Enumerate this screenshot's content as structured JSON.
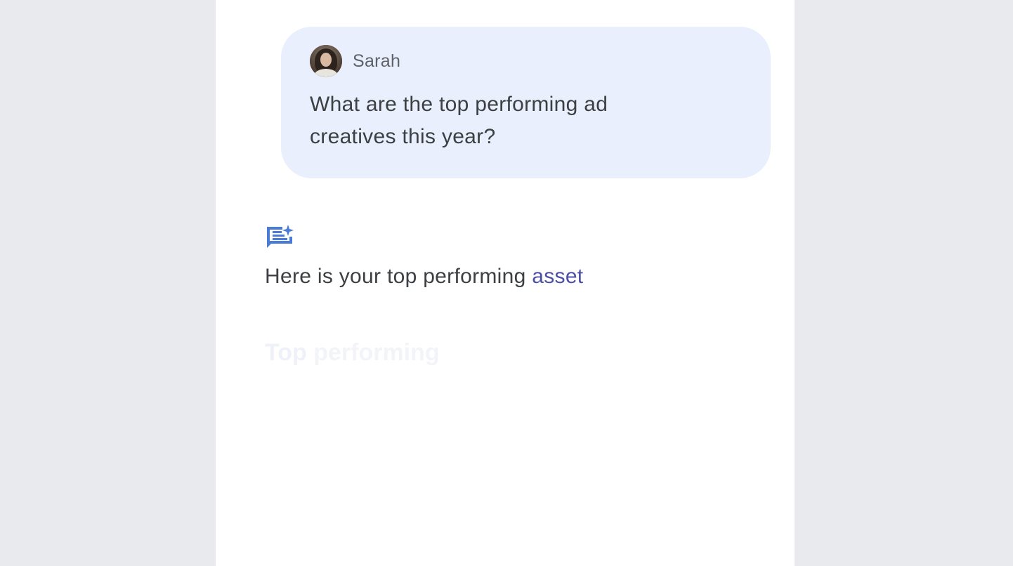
{
  "chat": {
    "user": {
      "name": "Sarah",
      "message": "What are the top performing ad creatives this year?"
    },
    "assistant": {
      "icon": "sparkle-chat-icon",
      "message_prefix": "Here is your top performing",
      "message_highlight": "asset"
    },
    "section": {
      "title_part1": "Top",
      "title_part2": "performing"
    }
  },
  "colors": {
    "background": "#e9eaed",
    "panel": "#ffffff",
    "user_bubble": "#e9effc",
    "assistant_icon": "#4a7bd6",
    "highlight_text": "#4b4fa6"
  }
}
